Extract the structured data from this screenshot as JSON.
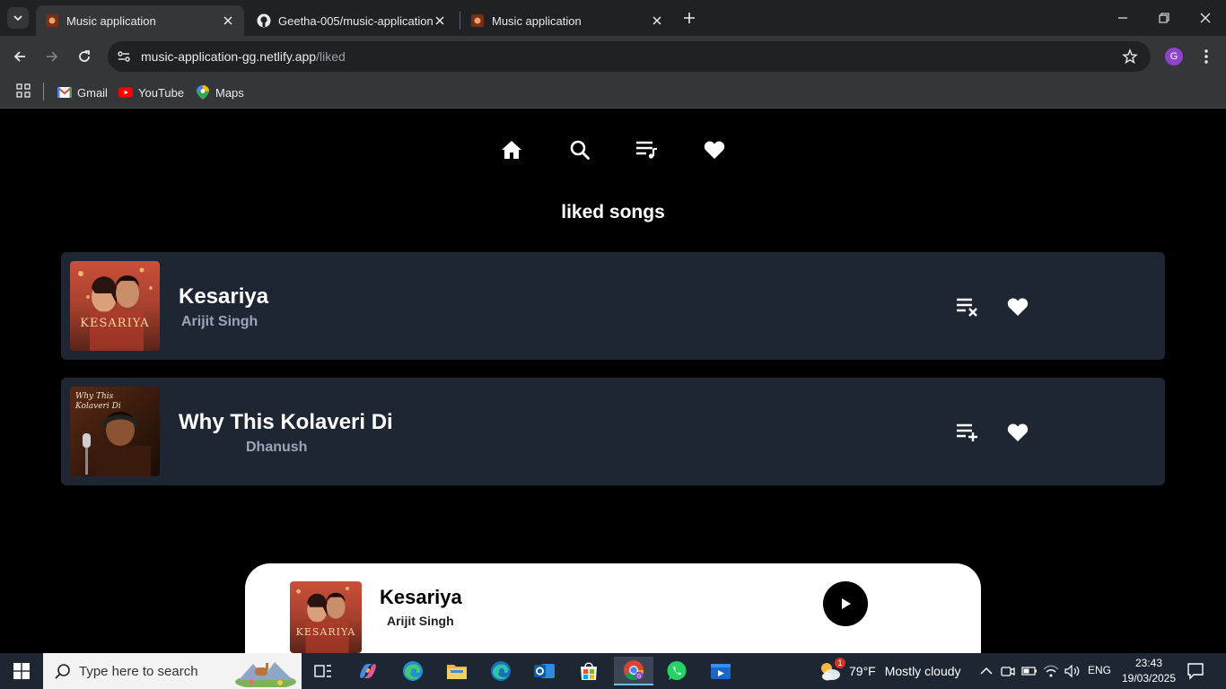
{
  "browser": {
    "tabs": [
      {
        "title": "Music application",
        "active": true
      },
      {
        "title": "Geetha-005/music-application",
        "active": false
      },
      {
        "title": "Music application",
        "active": false
      }
    ],
    "url_host": "music-application-gg.netlify.app",
    "url_path": "/liked",
    "profile_initial": "G",
    "bookmarks": [
      {
        "label": "Gmail",
        "icon": "gmail-icon"
      },
      {
        "label": "YouTube",
        "icon": "youtube-icon"
      },
      {
        "label": "Maps",
        "icon": "maps-icon"
      }
    ]
  },
  "app": {
    "nav": [
      {
        "name": "home",
        "icon": "home-icon"
      },
      {
        "name": "search",
        "icon": "search-icon"
      },
      {
        "name": "playlist",
        "icon": "playlist-icon"
      },
      {
        "name": "liked",
        "icon": "heart-icon"
      }
    ],
    "page_title": "liked songs",
    "songs": [
      {
        "title": "Kesariya",
        "artist": "Arijit Singh",
        "playlist_action": "playlist-remove-icon",
        "liked": true,
        "art_caption": "KESARIYA"
      },
      {
        "title": "Why This Kolaveri Di",
        "artist": "Dhanush",
        "playlist_action": "playlist-add-icon",
        "liked": true,
        "art_caption": "Why This Kolaveri Di"
      }
    ],
    "player": {
      "title": "Kesariya",
      "artist": "Arijit Singh",
      "art_caption": "KESARIYA"
    }
  },
  "taskbar": {
    "search_placeholder": "Type here to search",
    "weather": {
      "temp": "79°F",
      "condition": "Mostly cloudy",
      "badge": "1"
    },
    "language": "ENG",
    "time": "23:43",
    "date": "19/03/2025"
  },
  "colors": {
    "page_bg": "#000000",
    "card_bg": "#1f2633",
    "artist_text": "#9aa6b8",
    "player_bg": "#ffffff"
  }
}
